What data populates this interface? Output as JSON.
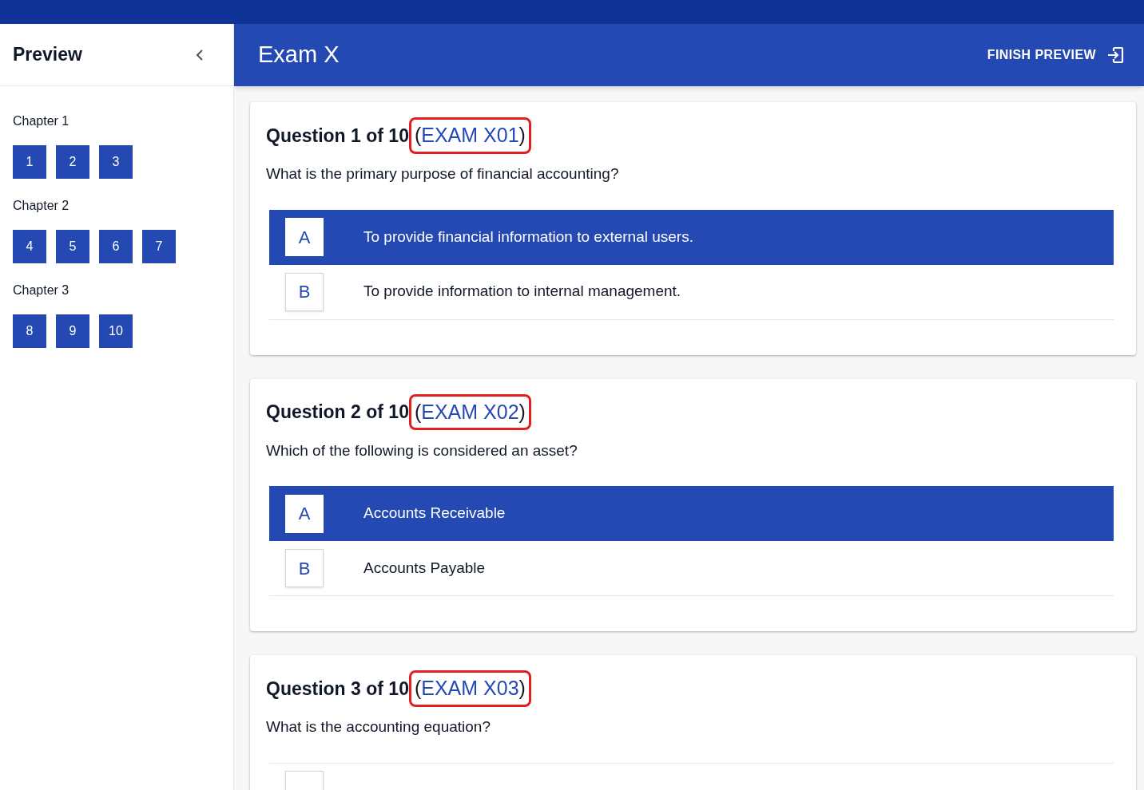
{
  "sidebar": {
    "title": "Preview",
    "chapters": [
      {
        "label": "Chapter 1",
        "questions": [
          "1",
          "2",
          "3"
        ]
      },
      {
        "label": "Chapter 2",
        "questions": [
          "4",
          "5",
          "6",
          "7"
        ]
      },
      {
        "label": "Chapter 3",
        "questions": [
          "8",
          "9",
          "10"
        ]
      }
    ]
  },
  "header": {
    "title": "Exam X",
    "action": "FINISH PREVIEW"
  },
  "questions": [
    {
      "title": "Question 1 of 10",
      "open": "(",
      "code": "EXAM X01",
      "close": ")",
      "annotated": true,
      "text": "What is the primary purpose of financial accounting?",
      "options": [
        {
          "letter": "A",
          "text": "To provide financial information to external users.",
          "selected": true
        },
        {
          "letter": "B",
          "text": "To provide information to internal management.",
          "selected": false
        }
      ]
    },
    {
      "title": "Question 2 of 10",
      "open": "(",
      "code": "EXAM X02",
      "close": ")",
      "annotated": true,
      "text": "Which of the following is considered an asset?",
      "options": [
        {
          "letter": "A",
          "text": "Accounts Receivable",
          "selected": true
        },
        {
          "letter": "B",
          "text": "Accounts Payable",
          "selected": false
        }
      ]
    },
    {
      "title": "Question 3 of 10",
      "open": "(",
      "code": "EXAM X03",
      "close": ")",
      "annotated": true,
      "text": "What is the accounting equation?",
      "options": [
        {
          "selected": false
        }
      ]
    }
  ]
}
